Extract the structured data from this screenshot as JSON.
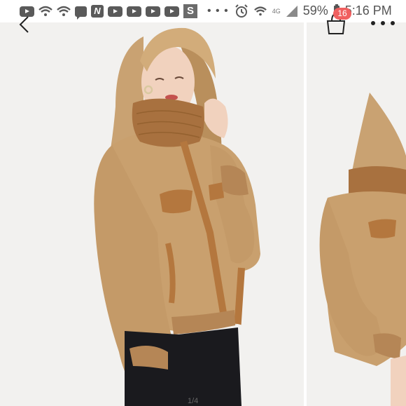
{
  "status_bar": {
    "battery": "59%",
    "time": "5:16 PM",
    "network": "4G",
    "notification_icons": [
      "youtube-icon",
      "wifi-icon",
      "wifi-icon",
      "chat-icon",
      "n-app-icon",
      "youtube-icon",
      "youtube-icon",
      "youtube-icon",
      "youtube-icon",
      "s-app-icon"
    ],
    "indicator_icons": [
      "more-dots-icon",
      "alarm-icon",
      "wifi-icon",
      "signal-icon",
      "battery-icon"
    ]
  },
  "app_bar": {
    "back_icon": "chevron-left-icon",
    "cart_icon": "shopping-bag-icon",
    "cart_count": "16",
    "more_icon": "more-horizontal-icon"
  },
  "gallery": {
    "images": [
      "main-product-photo",
      "next-product-photo"
    ],
    "page_indicator": "1/4"
  },
  "colors": {
    "badge": "#f06060",
    "jacket": "#c9a06e",
    "background": "#f2f1ef"
  }
}
